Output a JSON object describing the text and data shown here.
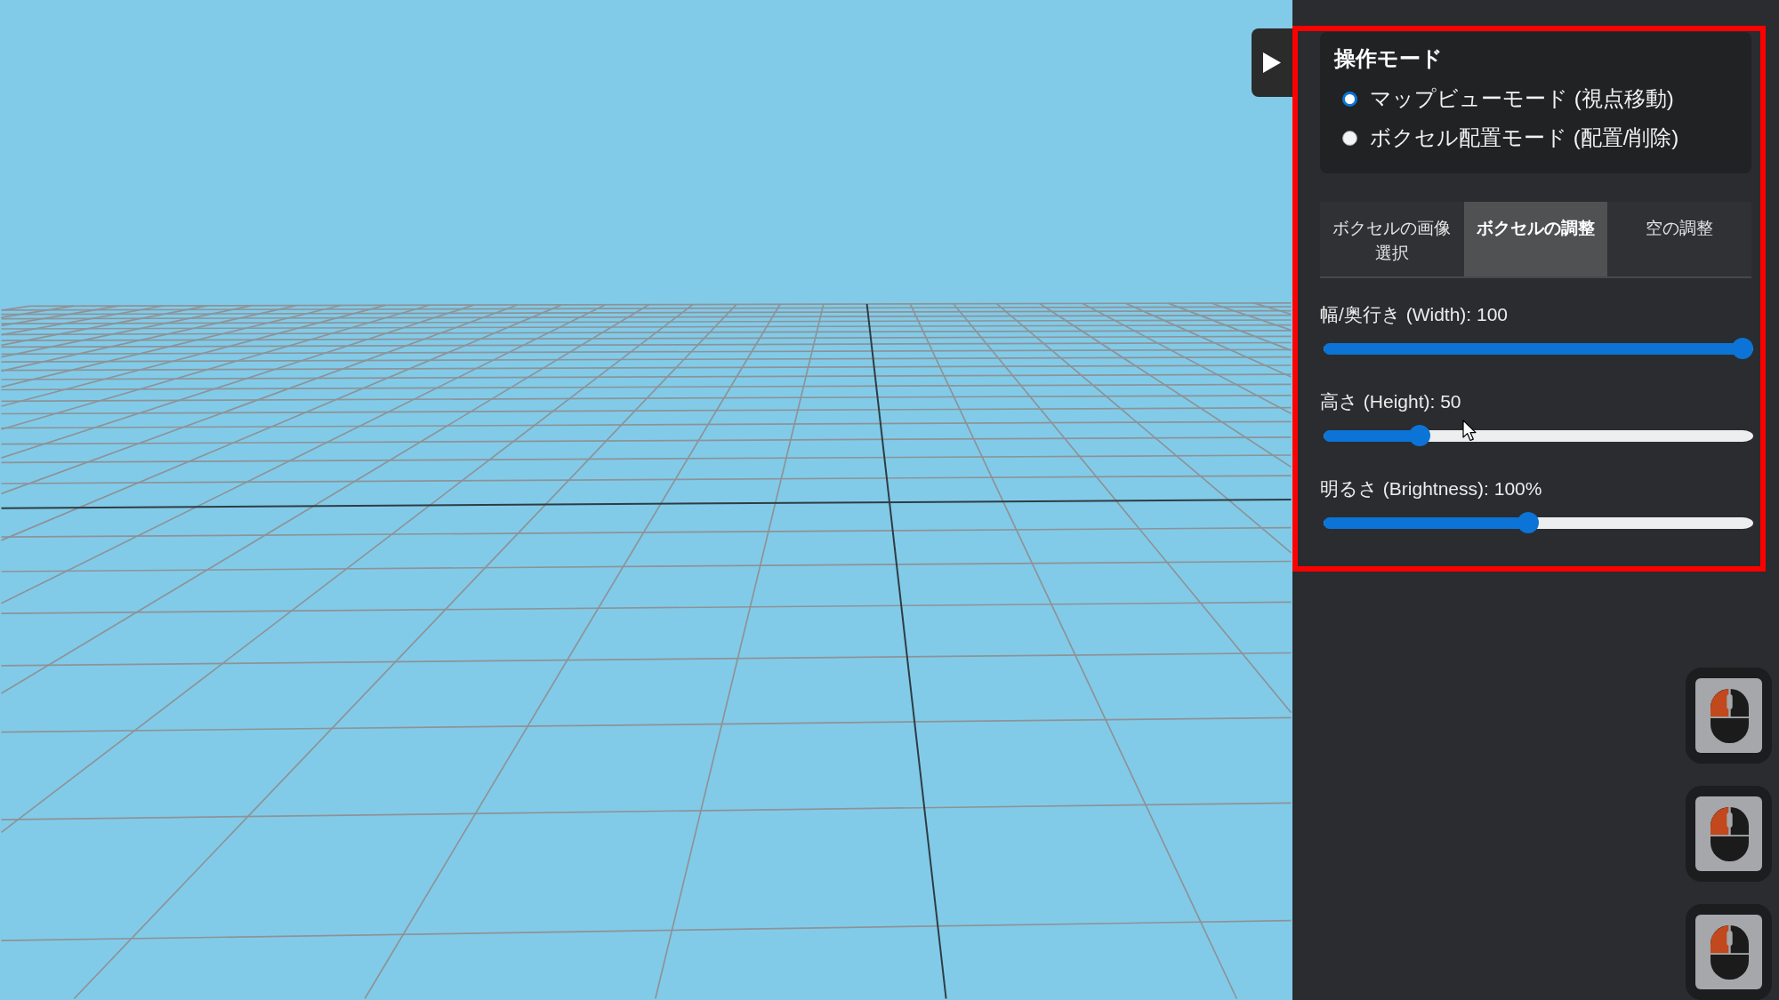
{
  "panel": {
    "mode_section": {
      "title": "操作モード",
      "options": [
        {
          "label": "マップビューモード (視点移動)",
          "selected": true
        },
        {
          "label": "ボクセル配置モード (配置/削除)",
          "selected": false
        }
      ]
    },
    "tabs": [
      {
        "label": "ボクセルの画像選択",
        "selected": false
      },
      {
        "label": "ボクセルの調整",
        "selected": true
      },
      {
        "label": "空の調整",
        "selected": false
      }
    ],
    "sliders": [
      {
        "label": "幅/奥行き (Width): 100",
        "level": 1.0
      },
      {
        "label": "高さ (Height): 50",
        "level": 0.21
      },
      {
        "label": "明るさ (Brightness): 100%",
        "level": 0.475
      }
    ]
  }
}
